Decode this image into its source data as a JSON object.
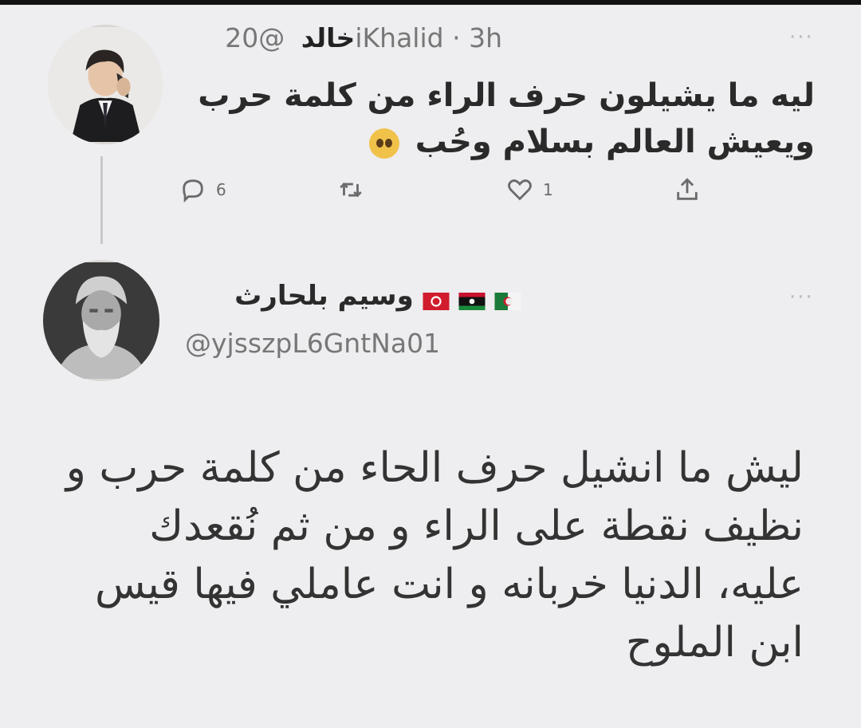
{
  "tweet1": {
    "display_name": "خالد",
    "handle": "@20iKhalid",
    "time": "3h",
    "text": "ليه ما يشيلون حرف الراء من كلمة حرب ويعيش العالم بسلام وحُب",
    "emoji": "pleading-face-emoji",
    "reply_count": "6",
    "like_count": "1",
    "icons": {
      "reply": "reply-icon",
      "retweet": "retweet-icon",
      "like": "heart-icon",
      "share": "share-icon",
      "more": "more-icon"
    }
  },
  "tweet2": {
    "display_name": "وسيم بلحارث",
    "flags": [
      "algeria-flag",
      "libya-flag",
      "tunisia-flag"
    ],
    "handle": "@yjsszpL6GntNa01",
    "text": "ليش ما انشيل حرف الحاء من كلمة حرب و نظيف نقطة على الراء و من ثم نُقعدك عليه، الدنيا خربانه و انت عاملي فيها قيس ابن الملوح"
  },
  "colors": {
    "background": "#eeedef",
    "text": "#2a2a2a",
    "secondary_text": "#777777"
  }
}
